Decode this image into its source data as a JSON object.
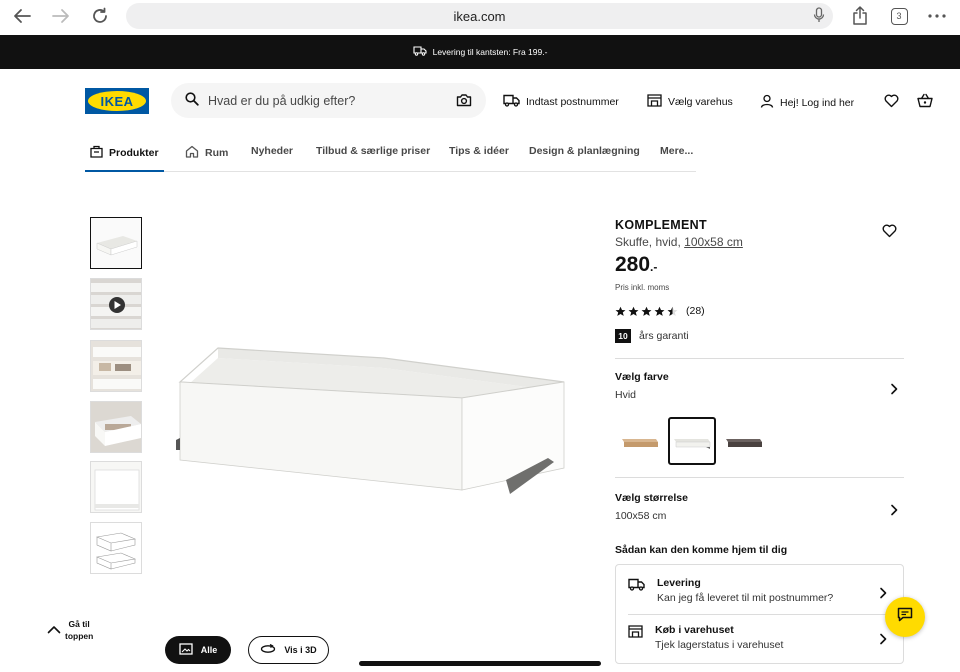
{
  "browser": {
    "url": "ikea.com",
    "tab_count": "3"
  },
  "banner": {
    "text": "Levering til kantsten: Fra 199.-"
  },
  "header": {
    "logo_text": "IKEA",
    "search_placeholder": "Hvad er du på udkig efter?",
    "postcode_label": "Indtast postnummer",
    "store_label": "Vælg varehus",
    "login_label": "Hej! Log ind her"
  },
  "nav": {
    "items": [
      {
        "label": "Produkter"
      },
      {
        "label": "Rum"
      },
      {
        "label": "Nyheder"
      },
      {
        "label": "Tilbud & særlige priser"
      },
      {
        "label": "Tips & idéer"
      },
      {
        "label": "Design & planlægning"
      },
      {
        "label": "Mere..."
      }
    ]
  },
  "product": {
    "name": "KOMPLEMENT",
    "desc_prefix": "Skuffe, hvid, ",
    "desc_size": "100x58 cm",
    "price": "280",
    "price_suffix": ".-",
    "price_note": "Pris inkl. moms",
    "rating_value": 4.5,
    "rating_max": 5,
    "rating_count": "(28)",
    "warranty_years": "10",
    "warranty_label": "års garanti"
  },
  "color": {
    "title": "Vælg farve",
    "value": "Hvid",
    "swatches": [
      {
        "name": "white-stained-oak",
        "color": "#c9a27a"
      },
      {
        "name": "white",
        "color": "#efefe9"
      },
      {
        "name": "black-brown",
        "color": "#4a4240"
      }
    ],
    "selected_index": 1
  },
  "size": {
    "title": "Vælg størrelse",
    "value": "100x58 cm"
  },
  "delivery": {
    "section_title": "Sådan kan den komme hjem til dig",
    "rows": [
      {
        "title": "Levering",
        "subtitle": "Kan jeg få leveret til mit postnummer?"
      },
      {
        "title": "Køb i varehuset",
        "subtitle": "Tjek lagerstatus i varehuset"
      }
    ]
  },
  "bottom": {
    "to_top_line1": "Gå til",
    "to_top_line2": "toppen",
    "all_label": "Alle",
    "view3d_label": "Vis i 3D"
  },
  "colors": {
    "ikea_blue": "#0058a3",
    "ikea_yellow": "#ffdb00"
  }
}
